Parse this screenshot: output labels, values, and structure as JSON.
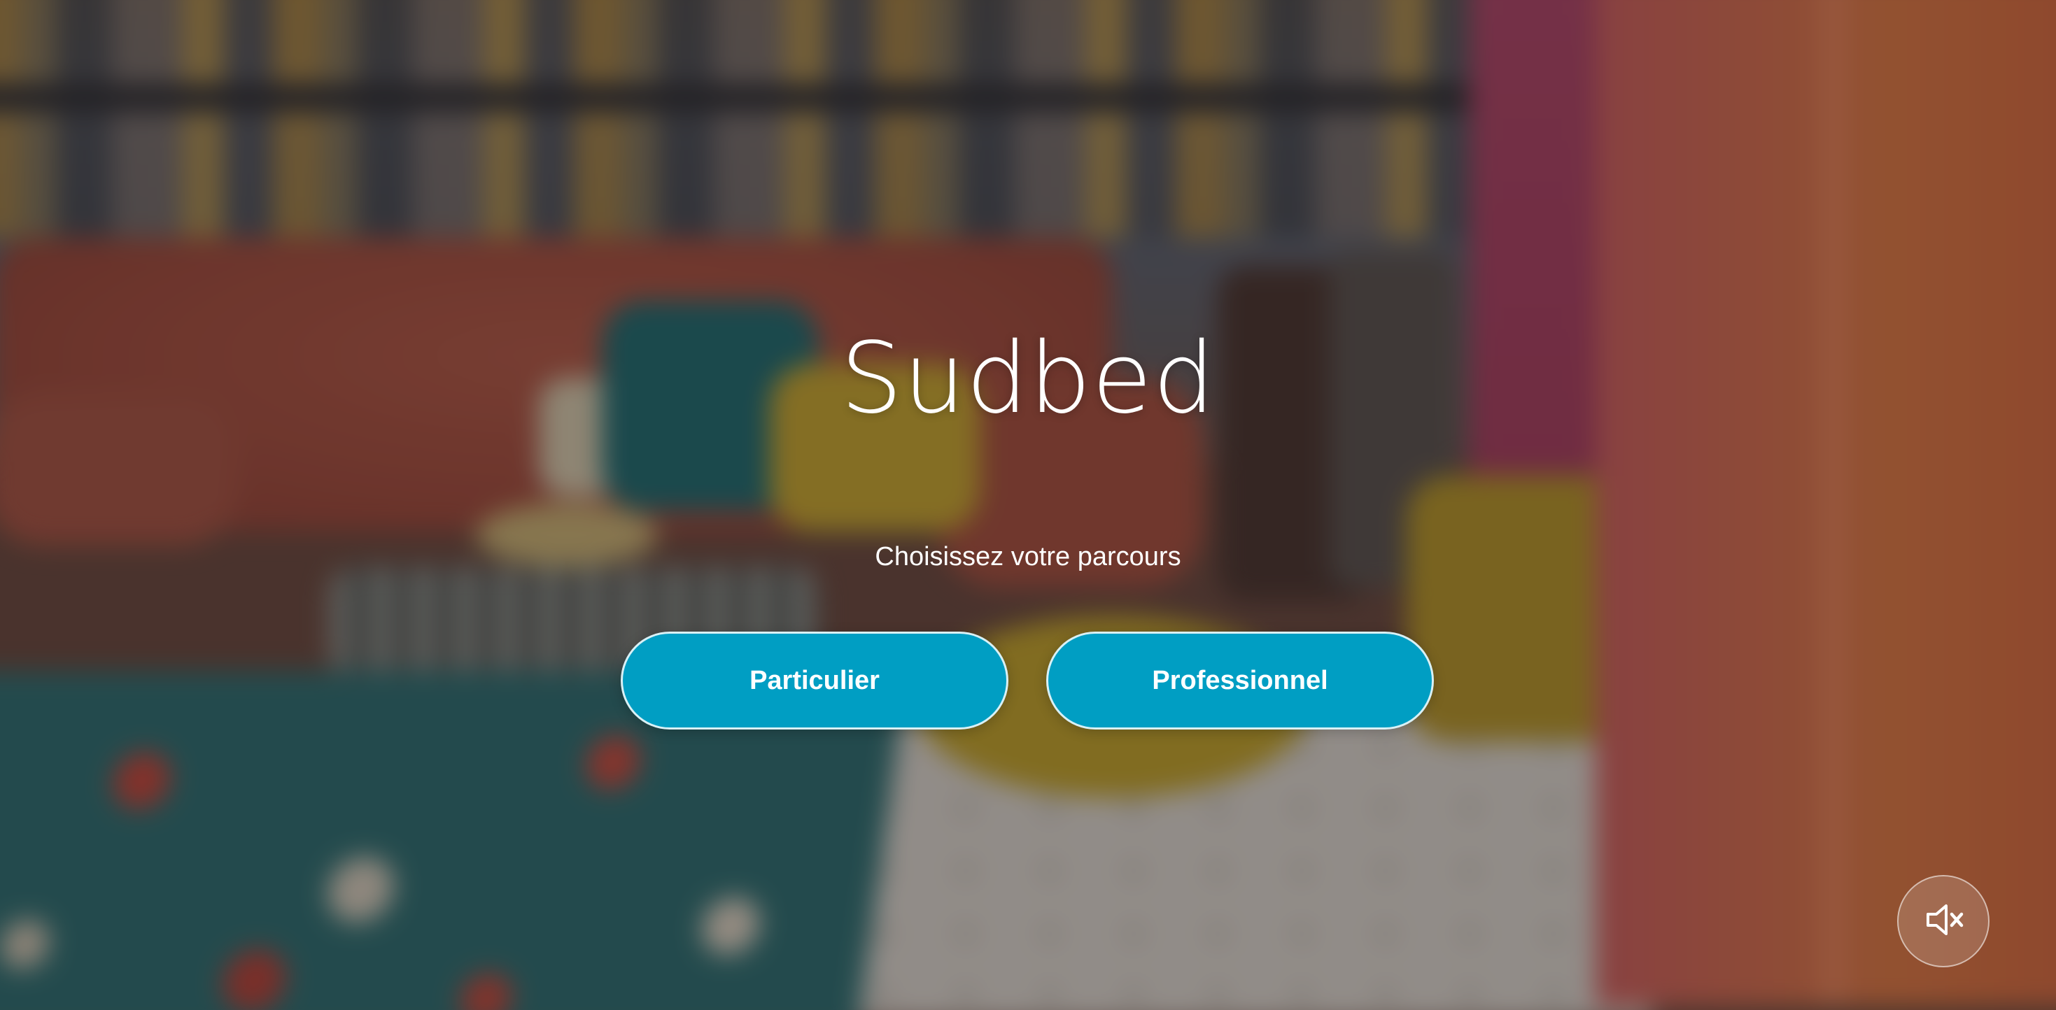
{
  "brand": {
    "title": "Sudbed"
  },
  "hero": {
    "subtitle": "Choisissez votre parcours"
  },
  "buttons": {
    "individual": "Particulier",
    "professional": "Professionnel"
  },
  "audio": {
    "icon": "volume-muted-icon",
    "state": "muted"
  },
  "colors": {
    "accent": "#009ec3",
    "text": "#ffffff"
  }
}
